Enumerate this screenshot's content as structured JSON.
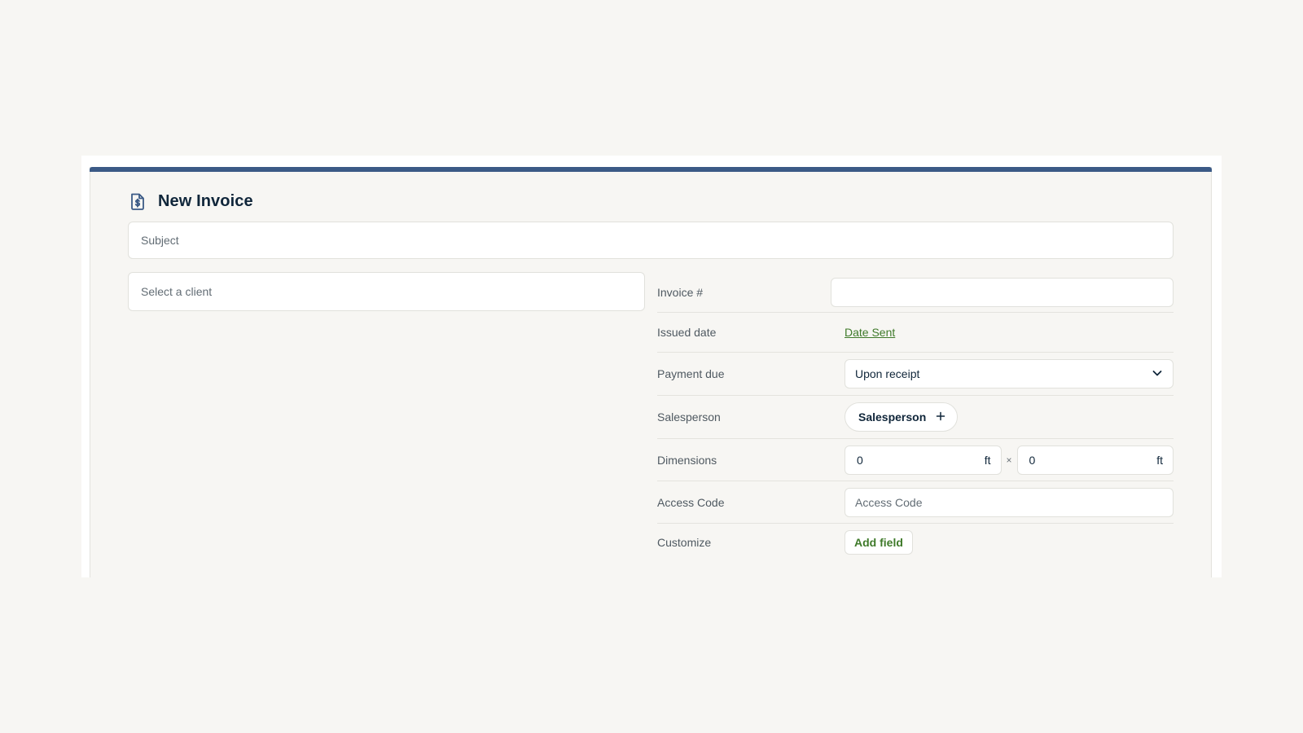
{
  "page": {
    "title": "New Invoice",
    "icon": "invoice-dollar-icon"
  },
  "colors": {
    "accent_bar": "#3b5a86",
    "link_green": "#3f7a2a",
    "background": "#f7f6f3"
  },
  "subject": {
    "placeholder": "Subject",
    "value": ""
  },
  "client": {
    "placeholder": "Select a client",
    "value": ""
  },
  "details": {
    "invoice_number": {
      "label": "Invoice #",
      "value": ""
    },
    "issued_date": {
      "label": "Issued date",
      "link_text": "Date Sent"
    },
    "payment_due": {
      "label": "Payment due",
      "selected": "Upon receipt",
      "icon": "chevron-down-icon"
    },
    "salesperson": {
      "label": "Salesperson",
      "button_text": "Salesperson",
      "icon": "plus-icon"
    },
    "dimensions": {
      "label": "Dimensions",
      "width": "0",
      "length": "0",
      "unit": "ft",
      "separator": "×"
    },
    "access_code": {
      "label": "Access Code",
      "placeholder": "Access Code",
      "value": ""
    },
    "customize": {
      "label": "Customize",
      "button_text": "Add field"
    }
  }
}
